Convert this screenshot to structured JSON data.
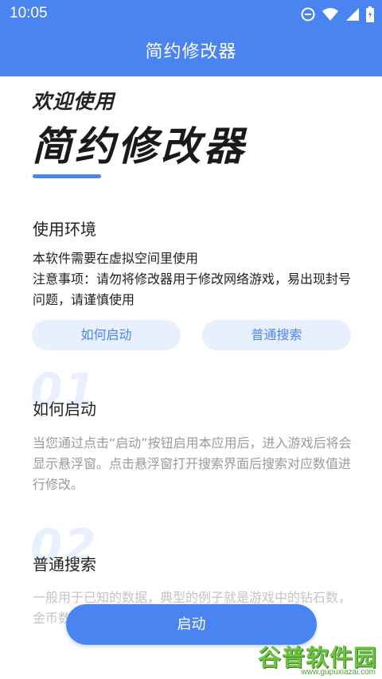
{
  "statusbar": {
    "time": "10:05"
  },
  "appbar": {
    "title": "简约修改器"
  },
  "welcome": {
    "line1": "欢迎使用",
    "line2": "简约修改器"
  },
  "environment": {
    "title": "使用环境",
    "line1": "本软件需要在虚拟空间里使用",
    "line2": "注意事项：请勿将修改器用于修改网络游戏，易出现封号问题，请谨慎使用"
  },
  "buttons": {
    "how_to_start": "如何启动",
    "normal_search": "普通搜索",
    "start": "启动"
  },
  "sections": [
    {
      "number": "01",
      "title": "如何启动",
      "text": "当您通过点击“启动”按钮启用本应用后，进入游戏后将会显示悬浮窗。点击悬浮窗打开搜索界面后搜索对应数值进行修改。"
    },
    {
      "number": "02",
      "title": "普通搜索",
      "text": "一般用于已知的数据，典型的例子就是游戏中的钻石数，金币数"
    }
  ],
  "watermark": {
    "logo": "谷普软件园",
    "url": "www.gupuxiazai.com"
  },
  "colors": {
    "accent": "#4a84f0",
    "pill_bg": "#e8f0fd"
  }
}
